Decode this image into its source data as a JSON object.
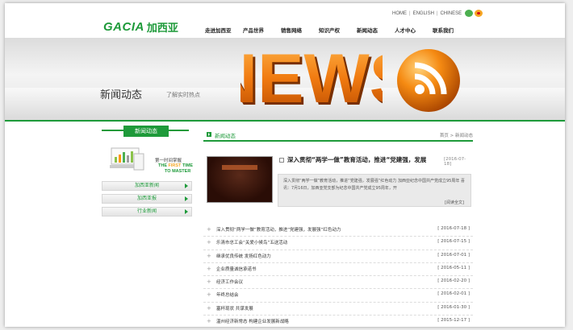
{
  "header": {
    "logo_latin": "GACIA",
    "logo_cn": "加西亚",
    "toplinks": [
      "HOME",
      "ENGLISH",
      "CHINESE"
    ],
    "nav": [
      "走进加西亚",
      "产品世界",
      "销售网络",
      "知识产权",
      "新闻动态",
      "人才中心",
      "联系我们"
    ]
  },
  "banner": {
    "title": "新闻动态",
    "subtitle": "了解实时热点",
    "big_word": "NEWS"
  },
  "sidebar": {
    "heading": "新闻动态",
    "promo_cn": "第一时间掌握",
    "promo_en_prefix": "THE ",
    "promo_en_highlight": "FIRST",
    "promo_en_suffix": " TIME",
    "promo_en_line2": "TO MASTER",
    "menu": [
      "加西亚新闻",
      "加西亚报",
      "行业新闻"
    ]
  },
  "main": {
    "section_title": "新闻动态",
    "breadcrumb": "首页 > 新闻动态",
    "feature": {
      "title": "深入贯彻“两学一做”教育活动，推进“党建强，发展",
      "date": "[2016-07-18]",
      "text": "深入贯彻“两学一做”教育活动，推进“党建强，发展强”红色动力 加西亚纪念中国共产党成立95周年 喜讯：7月16日，加西亚党支部为纪念中国共产党成立95周年，开",
      "more": "[阅读全文]"
    },
    "list": [
      {
        "title": "深入贯彻“两学一做”教育活动，推进“党建强，发展强”红色动力",
        "date": "[ 2016-07-18 ]"
      },
      {
        "title": "乐清市总工会“关爱小候鸟”五送活动",
        "date": "[ 2016-07-15 ]"
      },
      {
        "title": "继承优良传统 发扬红色动力",
        "date": "[ 2016-07-01 ]"
      },
      {
        "title": "企业质量诚信承诺书",
        "date": "[ 2016-05-11 ]"
      },
      {
        "title": "经济工作会议",
        "date": "[ 2016-02-20 ]"
      },
      {
        "title": "年终总结会",
        "date": "[ 2016-02-01 ]"
      },
      {
        "title": "塞杯现状 共谋发展",
        "date": "[ 2016-01-30 ]"
      },
      {
        "title": "温州经济新常态 构建企业发展新战略",
        "date": "[ 2015-12-17 ]"
      }
    ]
  },
  "colors": {
    "brand_green": "#1e9a3a",
    "accent_orange": "#f5a623"
  }
}
